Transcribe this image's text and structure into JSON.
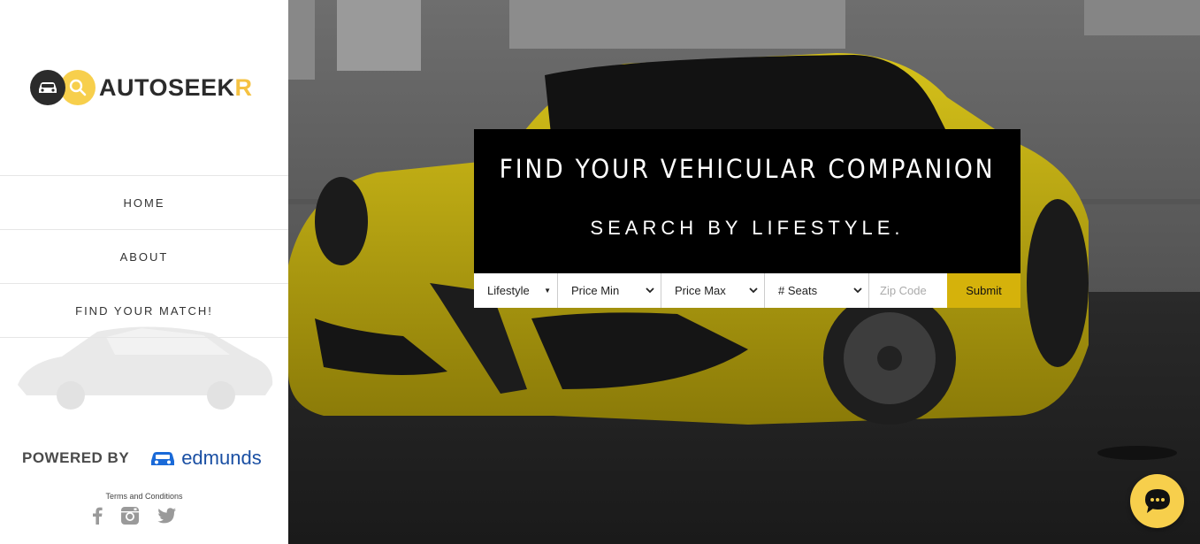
{
  "brand": {
    "name_main": "AUTOSEEK",
    "name_accent": "R",
    "accent_color": "#f5c242",
    "dark_color": "#2b2b2b"
  },
  "nav": {
    "items": [
      {
        "label": "HOME"
      },
      {
        "label": "ABOUT"
      },
      {
        "label": "FIND YOUR MATCH!"
      }
    ]
  },
  "footer": {
    "powered_by": "POWERED BY",
    "partner": "edmunds",
    "terms": "Terms and Conditions",
    "social_icons": [
      "facebook-icon",
      "instagram-icon",
      "twitter-icon"
    ]
  },
  "hero": {
    "headline": "FIND YOUR VEHICULAR COMPANION",
    "subheadline": "SEARCH BY LIFESTYLE.",
    "filters": {
      "lifestyle": "Lifestyle",
      "price_min": "Price Min",
      "price_max": "Price Max",
      "seats": "# Seats",
      "zip_placeholder": "Zip Code",
      "submit": "Submit"
    },
    "submit_color": "#d5b20b"
  },
  "chat": {
    "icon": "chat-bubble-icon",
    "color": "#f7cf4c"
  }
}
